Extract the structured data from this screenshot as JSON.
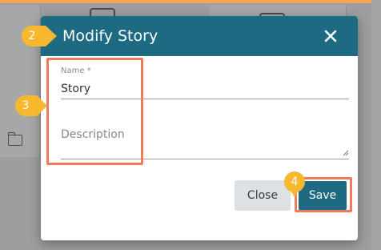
{
  "dialog": {
    "title": "Modify Story",
    "close_icon": "close-icon",
    "name_field": {
      "label": "Name *",
      "value": "Story"
    },
    "description_field": {
      "placeholder": "Description",
      "value": ""
    },
    "buttons": {
      "close_label": "Close",
      "save_label": "Save"
    }
  },
  "steps": [
    {
      "number": "2"
    },
    {
      "number": "3"
    },
    {
      "number": "4"
    }
  ],
  "colors": {
    "header": "#1d6a82",
    "badge": "#f5b82e",
    "highlight": "#ee7b5a"
  }
}
